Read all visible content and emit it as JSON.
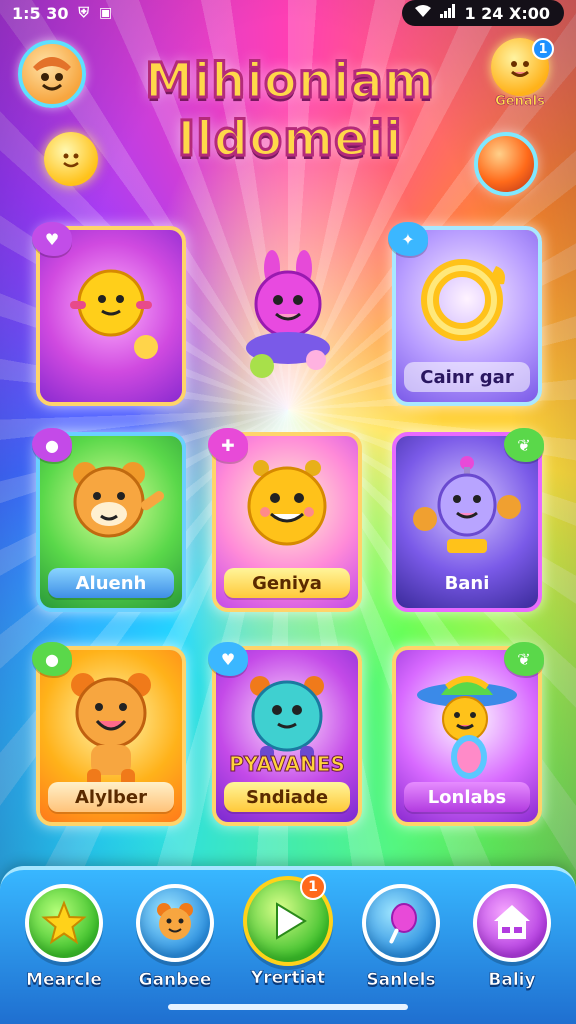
{
  "status_bar": {
    "time": "1:5 30",
    "right_text": "1 24 X:00"
  },
  "header": {
    "title_line1": "Mihioniam",
    "title_line2": "Ildomeii",
    "gems_badge": "1",
    "gems_label": "Genals"
  },
  "games": [
    {
      "label": ""
    },
    {
      "label": ""
    },
    {
      "label": "Cainr gar"
    },
    {
      "label": "Aluenh"
    },
    {
      "label": "Geniya"
    },
    {
      "label": "Bani"
    },
    {
      "label": "Alylber"
    },
    {
      "title": "PYAVANES",
      "label": "Sndiade"
    },
    {
      "label": "Lonlabs"
    }
  ],
  "nav": {
    "items": [
      {
        "label": "Mearcle",
        "icon": "star-icon"
      },
      {
        "label": "Ganbee",
        "icon": "character-icon"
      },
      {
        "label": "Yrertiat",
        "icon": "play-icon",
        "badge": "1"
      },
      {
        "label": "Sanlels",
        "icon": "lollipop-icon"
      },
      {
        "label": "Baliy",
        "icon": "house-icon"
      }
    ]
  },
  "colors": {
    "accent_yellow": "#ffd84a",
    "nav_blue": "#2f8fe8",
    "title_stroke": "#b42a7a"
  }
}
